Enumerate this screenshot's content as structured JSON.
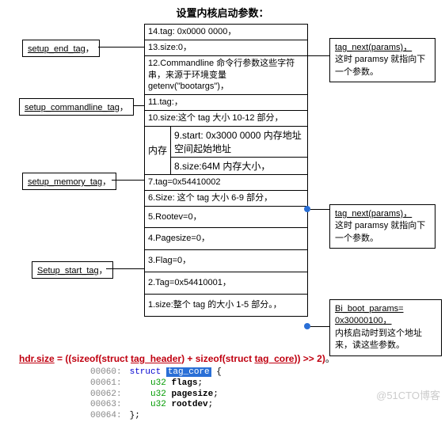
{
  "title": "设置内核启动参数：",
  "left_labels": {
    "end": "setup_end_tag",
    "cmd": "setup_commandline_tag",
    "mem": "setup_memory_tag",
    "start": "Setup_start_tag"
  },
  "stack": {
    "r14": "14.tag: 0x0000 0000",
    "r13": "13.size:0",
    "r12": "12.Commandline 命令行参数这些字符串，来源于环境变量 getenv(\"bootargs\")",
    "r11": "11.tag:",
    "r10": "10.size:这个 tag 大小 10-12 部分",
    "mem_label": "内存",
    "r9": "9.start: 0x3000 0000 内存地址空间起始地址",
    "r8": "8.size:64M 内存大小",
    "r7": "7.tag=0x54410002",
    "r6": "6.Size:  这个 tag 大小 6-9 部分",
    "r5": "5.Rootev=0",
    "r4": "4.Pagesize=0",
    "r3": "3.Flag=0",
    "r2": "2.Tag=0x54410001",
    "r1": "1.size:整个 tag 的大小 1-5 部分。"
  },
  "right": {
    "top_title": "tag_next(params)",
    "top_body": "这时 paramsy 就指向下一个参数。",
    "mid_title": "tag_next(params)",
    "mid_body": "这时 paramsy 就指向下一个参数。",
    "bot_title": "Bi_boot_params= 0x30000100，",
    "bot_body": "内核启动时到这个地址来，读这些参数。"
  },
  "formula": {
    "lhs": "hdr.size",
    "rhs1": "((sizeof(struct ",
    "rhs2": "tag_header",
    "rhs3": ") + sizeof(struct ",
    "rhs4": "tag_core",
    "rhs5": ")) >> 2)"
  },
  "code": {
    "l0": {
      "n": "00060:",
      "kw": "struct",
      "name": "tag_core",
      "br": " {"
    },
    "l1": {
      "n": "00061:",
      "t": "u32",
      "id": "flags"
    },
    "l2": {
      "n": "00062:",
      "t": "u32",
      "id": "pagesize"
    },
    "l3": {
      "n": "00063:",
      "t": "u32",
      "id": "rootdev"
    },
    "l4": {
      "n": "00064:",
      "end": "};"
    }
  },
  "watermark": "@51CTO博客"
}
